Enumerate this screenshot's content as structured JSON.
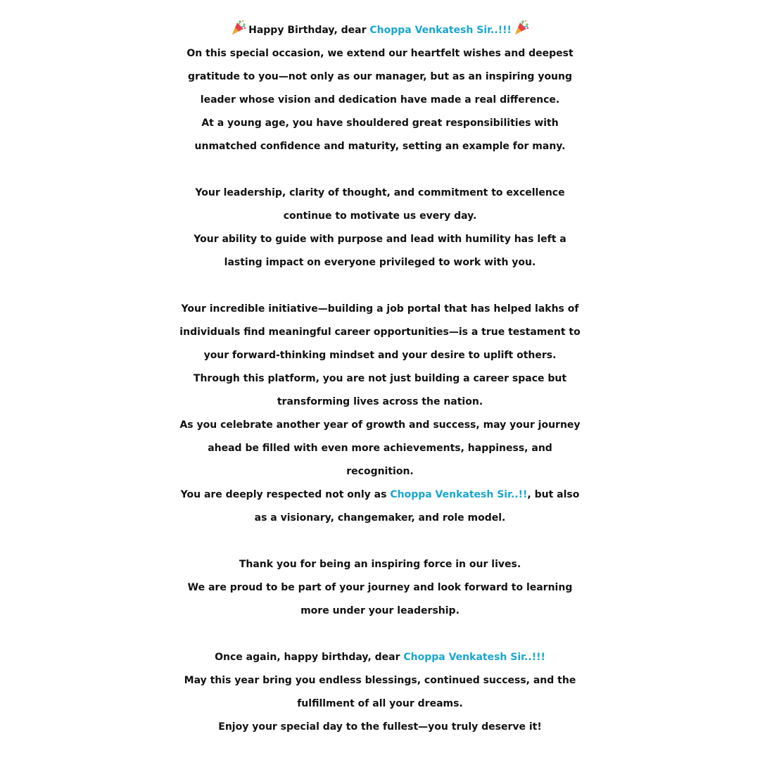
{
  "greeting": {
    "prefix": "Happy Birthday, dear ",
    "name": "Choppa Venkatesh Sir..!!!"
  },
  "para1": [
    "On this special occasion, we extend our heartfelt wishes and deepest",
    "gratitude to you—not only as our manager, but as an inspiring young",
    "leader whose vision and dedication have made a real difference.",
    "At a young age, you have shouldered great responsibilities with",
    "unmatched confidence and maturity, setting an example for many."
  ],
  "para2": [
    "Your leadership, clarity of thought, and commitment to excellence",
    "continue to motivate us every day.",
    "Your ability to guide with purpose and lead with humility has left a",
    "lasting impact on everyone privileged to work with you."
  ],
  "para3": [
    "Your incredible initiative—building a job portal that has helped lakhs of",
    "individuals find meaningful career opportunities—is a true testament to",
    "your forward-thinking mindset and your desire to uplift others.",
    "Through this platform, you are not just building a career space but",
    "transforming lives across the nation.",
    "As you celebrate another year of growth and success, may your journey",
    "ahead be filled with even more achievements, happiness, and",
    "recognition."
  ],
  "respect": {
    "prefix": "You are deeply respected not only as ",
    "name": "Choppa Venkatesh Sir..!!",
    "suffix": ", but also",
    "line2": "as a visionary, changemaker, and role model."
  },
  "para4": [
    "Thank you for being an inspiring force in our lives.",
    "We are proud to be part of your journey and look forward to learning",
    "more under your leadership."
  ],
  "closing": {
    "prefix": "Once again, happy birthday, dear ",
    "name": "Choppa Venkatesh Sir..!!!",
    "lines": [
      "May this year bring you endless blessings, continued success, and the",
      "fulfillment of all your dreams.",
      "Enjoy your special day to the fullest—you truly deserve it!"
    ]
  },
  "colors": {
    "text": "#111111",
    "highlight": "#1aa6cf",
    "background": "#ffffff"
  },
  "icons": {
    "left": "party-popper-icon",
    "right": "party-popper-icon"
  }
}
